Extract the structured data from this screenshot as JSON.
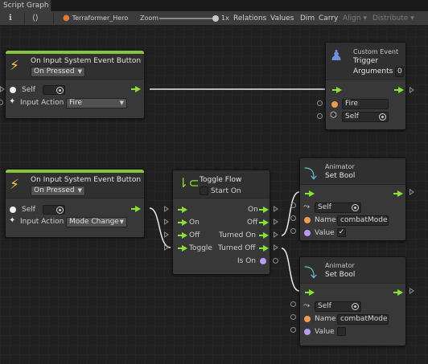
{
  "tab": {
    "title": "Script Graph"
  },
  "toolbar": {
    "graph_name": "Terraformer_Hero",
    "zoom_label": "Zoom",
    "zoom_value": "1x",
    "relations": "Relations",
    "values": "Values",
    "dim": "Dim",
    "carry": "Carry",
    "align": "Align",
    "distribute": "Distribute"
  },
  "nodes": {
    "event1": {
      "title": "On Input System Event Button",
      "mode": "On Pressed",
      "self_label": "Self",
      "input_action_label": "Input Action",
      "input_action_value": "Fire"
    },
    "trigger": {
      "subtitle": "Custom Event",
      "title_line1": "Trigger",
      "title_line2": "Arguments",
      "arguments_count": "0",
      "name_value": "Fire",
      "self_label": "Self"
    },
    "event2": {
      "title": "On Input System Event Button",
      "mode": "On Pressed",
      "self_label": "Self",
      "input_action_label": "Input Action",
      "input_action_value": "Mode Change"
    },
    "toggle": {
      "title": "Toggle Flow",
      "start_on_label": "Start On",
      "in_on": "On",
      "in_off": "Off",
      "in_toggle": "Toggle",
      "out_on": "On",
      "out_off": "Off",
      "out_turned_on": "Turned On",
      "out_turned_off": "Turned Off",
      "out_is_on": "Is On"
    },
    "setbool1": {
      "subtitle": "Animator",
      "title": "Set Bool",
      "self_label": "Self",
      "name_label": "Name",
      "name_value": "combatMode",
      "value_label": "Value",
      "value_checked": true,
      "check_mark": "✓"
    },
    "setbool2": {
      "subtitle": "Animator",
      "title": "Set Bool",
      "self_label": "Self",
      "name_label": "Name",
      "name_value": "combatMode",
      "value_label": "Value",
      "value_checked": false
    }
  },
  "colors": {
    "flow": "#8ae234",
    "event_bar": "#8ac43f",
    "string_port": "#f09b50",
    "bool_port": "#b89cf0",
    "bolt": "#f5c542",
    "wire": "#e8e8e8"
  },
  "icons": [
    "info-icon",
    "link-icon",
    "graph-icon",
    "bolt-icon",
    "target-icon",
    "gameobject-icon",
    "custom-event-icon",
    "toggle-icon",
    "animator-icon",
    "flow-arrow-icon"
  ]
}
